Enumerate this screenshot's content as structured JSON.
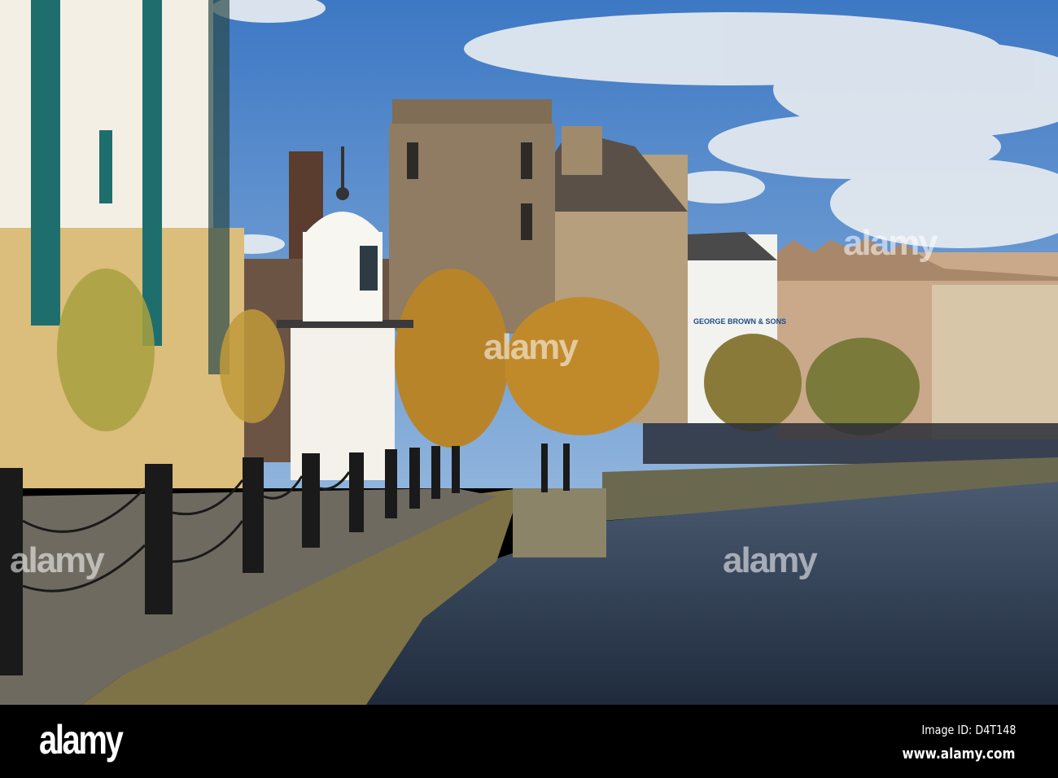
{
  "photo": {
    "sign_text": "GEORGE BROWN & SONS",
    "colors": {
      "sky": "#4f86c9",
      "water": "#2a3a52",
      "stone": "#9c8a6a",
      "foliage": "#c08a2a"
    }
  },
  "watermark": {
    "text": "alamy"
  },
  "footer": {
    "logo": "alamy",
    "image_id": "Image ID: D4T148",
    "website": "www.alamy.com"
  }
}
